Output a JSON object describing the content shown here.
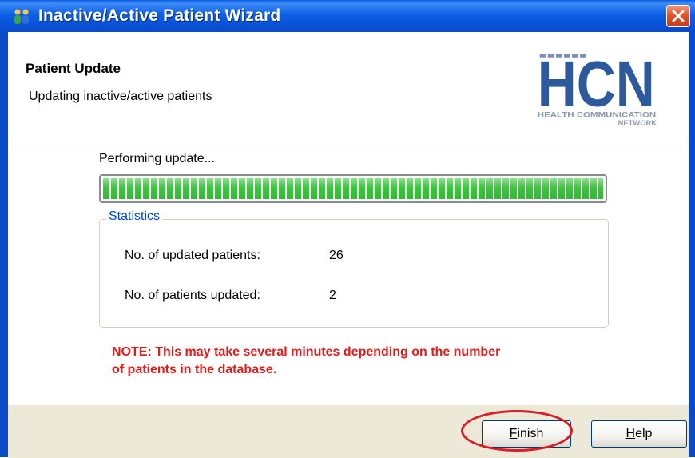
{
  "window": {
    "title": "Inactive/Active Patient Wizard",
    "icon": "patients-icon",
    "close_icon": "close-icon"
  },
  "header": {
    "title": "Patient Update",
    "subtitle": "Updating inactive/active patients",
    "logo": {
      "text": "HCN",
      "tagline_1": "HEALTH COMMUNICATION",
      "tagline_2": "NETWORK",
      "color": "#2d5a9c"
    }
  },
  "progress": {
    "label": "Performing update...",
    "value_percent": 100,
    "color": "#39c73b"
  },
  "statistics": {
    "legend": "Statistics",
    "rows": [
      {
        "label": "No. of updated patients:",
        "value": "26"
      },
      {
        "label": "No. of patients updated:",
        "value": "2"
      }
    ]
  },
  "note": {
    "line1": "NOTE: This may take several minutes depending on the number",
    "line2": "of patients in the database.",
    "color": "#e51a1a"
  },
  "buttons": {
    "finish": {
      "label_first": "F",
      "label_rest": "inish"
    },
    "help": {
      "label_first": "H",
      "label_rest": "elp"
    }
  },
  "annotation": {
    "color": "#d71e26"
  }
}
